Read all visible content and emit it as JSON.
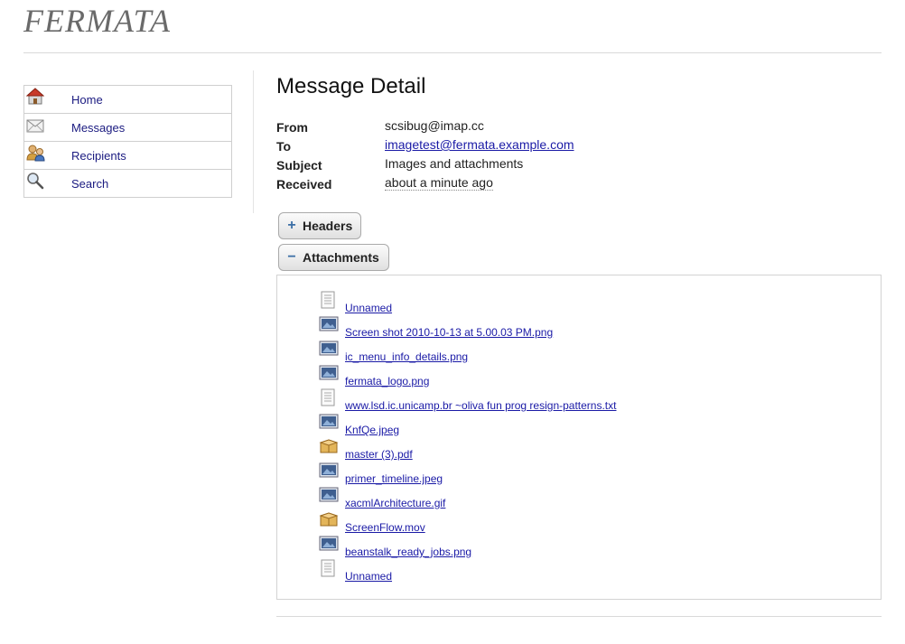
{
  "app": {
    "brand": "FERMATA"
  },
  "nav": {
    "items": [
      {
        "label": "Home",
        "icon": "home-icon"
      },
      {
        "label": "Messages",
        "icon": "messages-icon"
      },
      {
        "label": "Recipients",
        "icon": "recipients-icon"
      },
      {
        "label": "Search",
        "icon": "search-icon"
      }
    ]
  },
  "page": {
    "title": "Message Detail"
  },
  "message": {
    "from_label": "From",
    "from": "scsibug@imap.cc",
    "to_label": "To",
    "to": "imagetest@fermata.example.com",
    "subject_label": "Subject",
    "subject": "Images and attachments",
    "received_label": "Received",
    "received": "about a minute ago"
  },
  "buttons": {
    "headers_label": "Headers",
    "headers_glyph": "+",
    "attachments_label": "Attachments",
    "attachments_glyph": "−"
  },
  "attachments": [
    {
      "name": "Unnamed",
      "icon": "text-file-icon"
    },
    {
      "name": "Screen shot 2010-10-13 at 5.00.03 PM.png",
      "icon": "image-file-icon"
    },
    {
      "name": "ic_menu_info_details.png",
      "icon": "image-file-icon"
    },
    {
      "name": "fermata_logo.png",
      "icon": "image-file-icon"
    },
    {
      "name": "www.lsd.ic.unicamp.br ~oliva fun prog resign-patterns.txt",
      "icon": "text-file-icon"
    },
    {
      "name": "KnfQe.jpeg",
      "icon": "image-file-icon"
    },
    {
      "name": "master (3).pdf",
      "icon": "package-file-icon"
    },
    {
      "name": "primer_timeline.jpeg",
      "icon": "image-file-icon"
    },
    {
      "name": "xacmlArchitecture.gif",
      "icon": "image-file-icon"
    },
    {
      "name": "ScreenFlow.mov",
      "icon": "package-file-icon"
    },
    {
      "name": "beanstalk_ready_jobs.png",
      "icon": "image-file-icon"
    },
    {
      "name": "Unnamed",
      "icon": "text-file-icon"
    }
  ],
  "colors": {
    "link": "#1a1aa6",
    "nav_link": "#1a1a80",
    "brand": "#6a6a6a"
  }
}
